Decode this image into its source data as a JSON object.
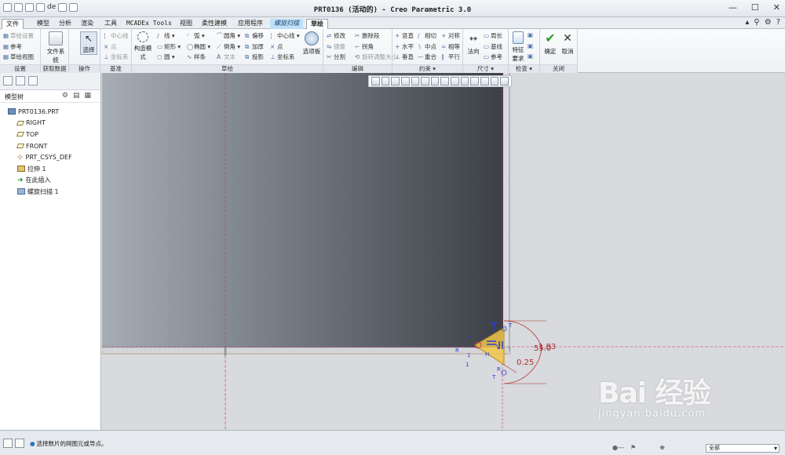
{
  "window": {
    "title": "PRT0136 (活动的) - Creo Parametric 3.0"
  },
  "quick_access": {
    "undo_label": "de"
  },
  "tabs": [
    {
      "label": "文件",
      "x": 2
    },
    {
      "label": "模型"
    },
    {
      "label": "分析"
    },
    {
      "label": "渲染"
    },
    {
      "label": "工具"
    },
    {
      "label": "MCADEx Tools"
    },
    {
      "label": "视图"
    },
    {
      "label": "柔性建模"
    },
    {
      "label": "应用程序"
    },
    {
      "label": "螺旋扫描"
    },
    {
      "label": "草绘"
    }
  ],
  "ribbon": {
    "settings": {
      "items": [
        "草绘设置",
        "参考",
        "草绘视图"
      ],
      "label": "设置"
    },
    "get_data": {
      "big": "文件系统",
      "label": "获取数据"
    },
    "operations": {
      "big": "选择",
      "label": "操作"
    },
    "datum": {
      "items": [
        "中心线",
        "点",
        "坐标系"
      ],
      "label": "基准"
    },
    "sketch": {
      "big": "构造模式",
      "col1": [
        "线",
        "矩形",
        "圆"
      ],
      "col2": [
        "弧",
        "椭圆",
        "样条"
      ],
      "col3": [
        "圆角",
        "倒角",
        "文本"
      ],
      "col4": [
        "偏移",
        "加厚",
        "投影"
      ],
      "col5": [
        "中心线",
        "点",
        "坐标系"
      ],
      "big2": "选项板",
      "label": "草绘"
    },
    "edit": {
      "col1": [
        "修改",
        "镜像",
        "分割"
      ],
      "col2": [
        "删除段",
        "拐角",
        "旋转调整大小"
      ],
      "label": "编辑"
    },
    "constrain": {
      "col1": [
        "竖直",
        "水平",
        "垂直"
      ],
      "col2": [
        "相切",
        "中点",
        "重合"
      ],
      "col3": [
        "对称",
        "相等",
        "平行"
      ],
      "label": "约束"
    },
    "dimension": {
      "big": "法向",
      "items": [
        "周长",
        "基线",
        "参考"
      ],
      "label": "尺寸"
    },
    "inspect": {
      "big": "特征要求",
      "label": "检查"
    },
    "close": {
      "ok": "确定",
      "cancel": "取消",
      "label": "关闭"
    }
  },
  "model_tree": {
    "header": "模型树",
    "nodes": [
      {
        "label": "PRT0136.PRT",
        "icon": "part-icon"
      },
      {
        "label": "RIGHT",
        "icon": "datum-plane-icon"
      },
      {
        "label": "TOP",
        "icon": "datum-plane-icon"
      },
      {
        "label": "FRONT",
        "icon": "datum-plane-icon"
      },
      {
        "label": "PRT_CSYS_DEF",
        "icon": "csys-icon"
      },
      {
        "label": "拉伸 1",
        "icon": "extrude-icon"
      },
      {
        "label": "在此插入",
        "icon": "insert-arrow-icon"
      },
      {
        "label": "螺旋扫描 1",
        "icon": "helical-sweep-icon"
      }
    ]
  },
  "sketch_dims": {
    "d1": "1.83",
    "d2": "55.0",
    "d3": "0.25",
    "constraint_labels": [
      "T",
      "T",
      "T",
      "R",
      "R",
      "1",
      "1",
      "H",
      "V",
      "T"
    ]
  },
  "status": {
    "message": "选择数片的网图元或导点。",
    "filter": "全部"
  },
  "watermark": {
    "brand": "Bai 经验",
    "url": "jingyan.baidu.com"
  },
  "colors": {
    "accent": "#2a70c0",
    "sketch_magenta": "#c0306a",
    "dim_red": "#b03030",
    "constraint_blue": "#2b3fd0",
    "section_fill": "#f0c64a"
  }
}
